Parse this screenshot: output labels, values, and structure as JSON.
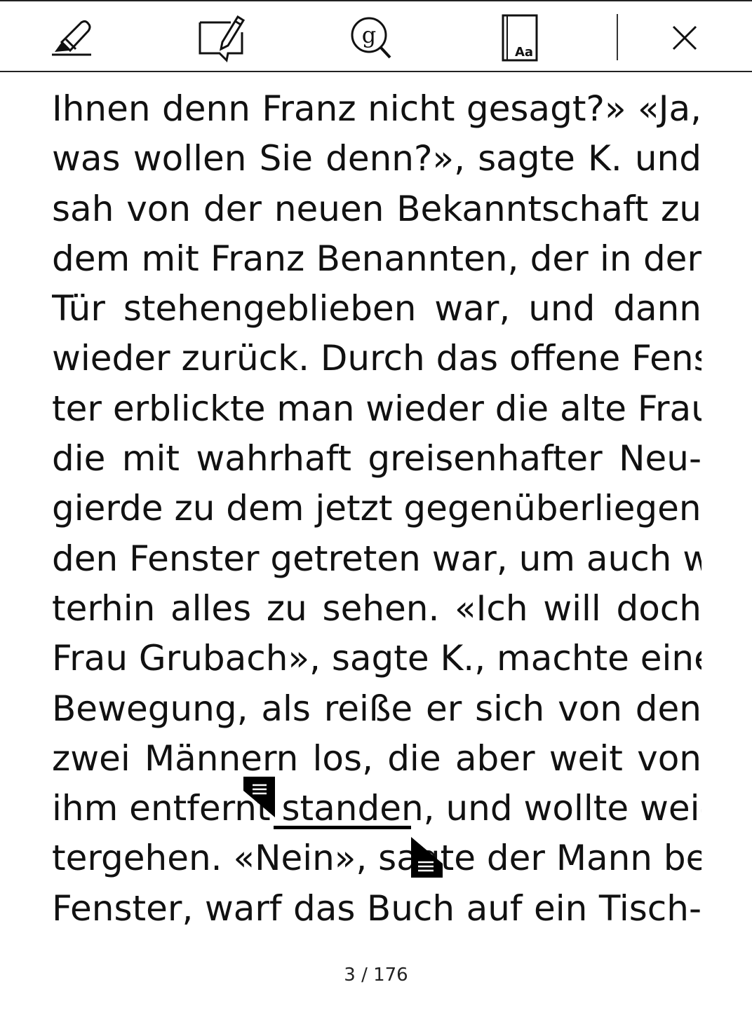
{
  "toolbar": {
    "tools": [
      {
        "name": "highlighter-tool",
        "icon": "highlighter-icon"
      },
      {
        "name": "note-tool",
        "icon": "note-pencil-icon"
      },
      {
        "name": "google-search-tool",
        "icon": "google-search-icon"
      },
      {
        "name": "dictionary-tool",
        "icon": "dictionary-book-icon",
        "label": "Aa"
      },
      {
        "name": "close-tool",
        "icon": "close-icon"
      }
    ]
  },
  "book": {
    "lines": [
      "Ihnen denn Franz nicht gesagt?» «Ja,",
      "was wollen Sie denn?», sagte K. und",
      "sah von der neuen Bekanntschaft zu",
      "dem mit Franz Benannten, der in der",
      "Tür stehengeblieben war, und dann",
      "wieder zurück. Durch das offene Fens-",
      "ter erblickte man wieder die alte Frau,",
      "die mit wahrhaft greisenhafter Neu-",
      "gierde zu dem jetzt gegenüberliegen-",
      "den Fenster getreten war, um auch wei-",
      "terhin alles zu sehen. «Ich will doch",
      "Frau Grubach», sagte K., machte eine",
      "Bewegung, als reiße er sich von den",
      "zwei Männern los, die aber weit von",
      "",
      "tergehen. «Nein», sagte der Mann beim",
      "Fenster, warf das Buch auf ein Tisch-"
    ],
    "selection_line": {
      "before": "ihm entfernt ",
      "selected": "standen",
      "after": ", und wollte wei-"
    }
  },
  "footer": {
    "page_indicator": "3 / 176"
  },
  "colors": {
    "ink": "#111111",
    "background": "#ffffff"
  }
}
